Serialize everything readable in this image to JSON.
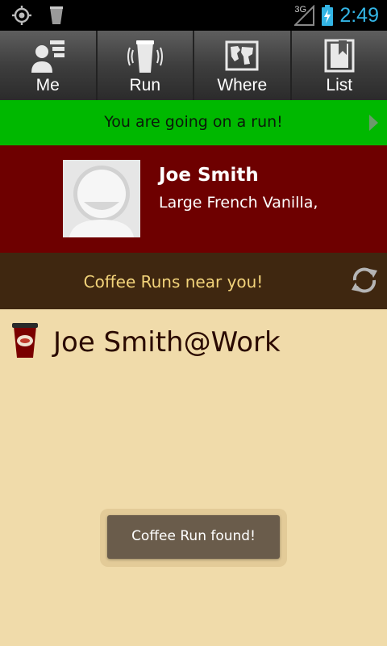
{
  "status_bar": {
    "network_type": "3G",
    "time": "2:49",
    "icons": [
      "gps-icon",
      "cup-notification-icon",
      "signal-icon",
      "battery-charging-icon"
    ]
  },
  "tabs": [
    {
      "label": "Me",
      "icon": "contacts-icon"
    },
    {
      "label": "Run",
      "icon": "run-cup-icon"
    },
    {
      "label": "Where",
      "icon": "map-icon"
    },
    {
      "label": "List",
      "icon": "list-bookmark-icon"
    }
  ],
  "run_banner": {
    "text": "You are going on a run!",
    "icon": "arrow-right-icon",
    "color": "#00b800"
  },
  "profile": {
    "name": "Joe Smith",
    "order": "Large French Vanilla,",
    "background": "#6e0000"
  },
  "nearby": {
    "text": "Coffee Runs near you!",
    "icon": "refresh-icon"
  },
  "runs": [
    {
      "name": "Joe Smith@Work",
      "icon": "coffee-cup-icon"
    }
  ],
  "toast": {
    "text": "Coffee Run found!"
  },
  "colors": {
    "accent": "#33b5e5",
    "page_background": "#f0dbaa",
    "near_bar": "#3f2710",
    "near_text": "#f2d37a"
  }
}
